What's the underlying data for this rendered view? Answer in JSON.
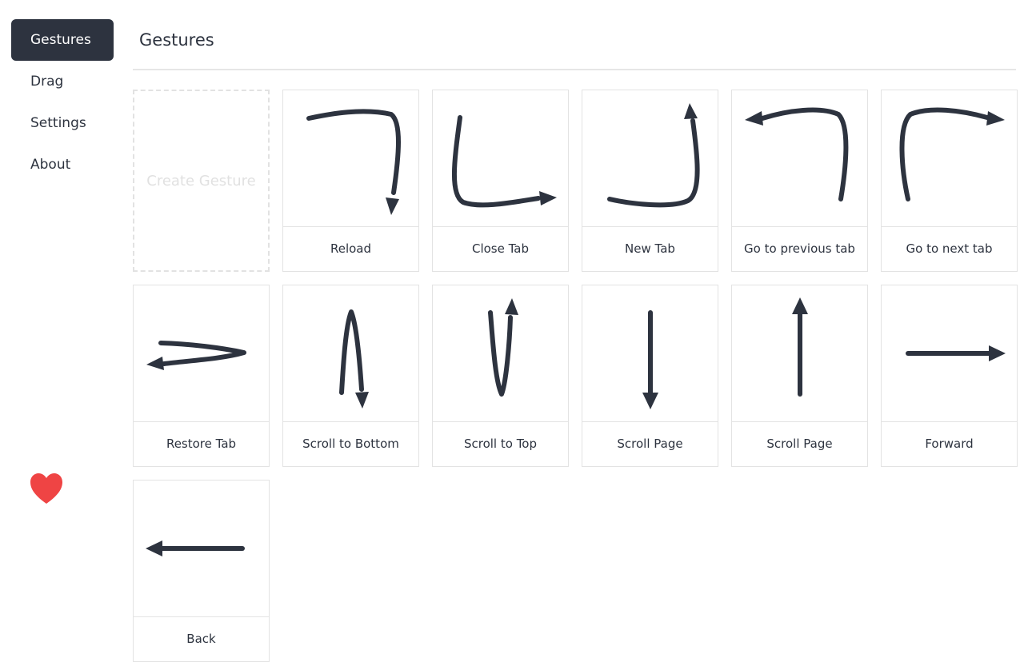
{
  "sidebar": {
    "items": [
      {
        "label": "Gestures",
        "active": true
      },
      {
        "label": "Drag",
        "active": false
      },
      {
        "label": "Settings",
        "active": false
      },
      {
        "label": "About",
        "active": false
      }
    ],
    "heart_icon": "heart-icon",
    "heart_color": "#ef4444"
  },
  "header": {
    "title": "Gestures"
  },
  "grid": {
    "create_label": "Create Gesture",
    "gestures": [
      {
        "label": "Reload"
      },
      {
        "label": "Close Tab"
      },
      {
        "label": "New Tab"
      },
      {
        "label": "Go to previous tab"
      },
      {
        "label": "Go to next tab"
      },
      {
        "label": "Restore Tab"
      },
      {
        "label": "Scroll to Bottom"
      },
      {
        "label": "Scroll to Top"
      },
      {
        "label": "Scroll Page"
      },
      {
        "label": "Scroll Page"
      },
      {
        "label": "Forward"
      },
      {
        "label": "Back"
      }
    ]
  },
  "colors": {
    "ink": "#2d333f",
    "active_bg": "#2d333f",
    "border": "#e3e3e3"
  }
}
